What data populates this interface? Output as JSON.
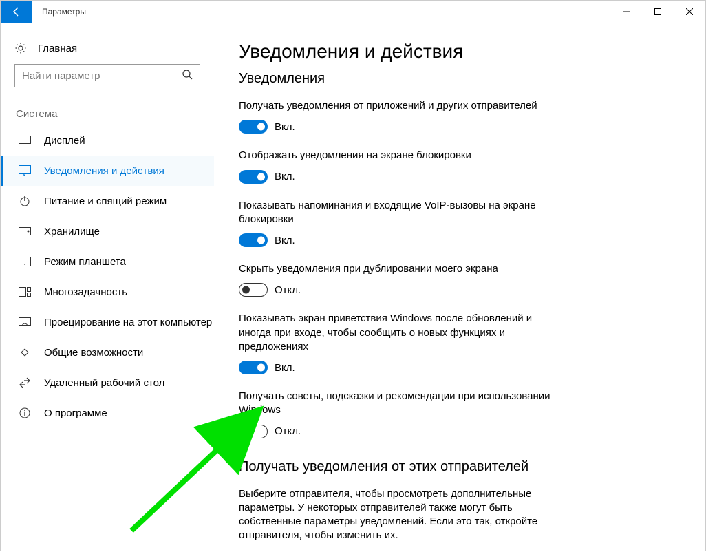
{
  "titlebar": {
    "title": "Параметры"
  },
  "sidebar": {
    "home": "Главная",
    "search_placeholder": "Найти параметр",
    "group": "Система",
    "items": [
      {
        "label": "Дисплей"
      },
      {
        "label": "Уведомления и действия"
      },
      {
        "label": "Питание и спящий режим"
      },
      {
        "label": "Хранилище"
      },
      {
        "label": "Режим планшета"
      },
      {
        "label": "Многозадачность"
      },
      {
        "label": "Проецирование на этот компьютер"
      },
      {
        "label": "Общие возможности"
      },
      {
        "label": "Удаленный рабочий стол"
      },
      {
        "label": "О программе"
      }
    ]
  },
  "main": {
    "heading": "Уведомления и действия",
    "section1": "Уведомления",
    "settings": [
      {
        "label": "Получать уведомления от приложений и других отправителей",
        "state": "on",
        "state_text": "Вкл."
      },
      {
        "label": "Отображать уведомления на экране блокировки",
        "state": "on",
        "state_text": "Вкл."
      },
      {
        "label": "Показывать напоминания и входящие VoIP-вызовы на экране блокировки",
        "state": "on",
        "state_text": "Вкл."
      },
      {
        "label": "Скрыть уведомления при дублировании моего экрана",
        "state": "off",
        "state_text": "Откл."
      },
      {
        "label": "Показывать экран приветствия Windows после обновлений и иногда при входе, чтобы сообщить о новых функциях и предложениях",
        "state": "on",
        "state_text": "Вкл."
      },
      {
        "label": "Получать советы, подсказки и рекомендации при использовании Windows",
        "state": "off",
        "state_text": "Откл."
      }
    ],
    "section2": "Получать уведомления от этих отправителей",
    "section2_desc": "Выберите отправителя, чтобы просмотреть дополнительные параметры. У некоторых отправителей также могут быть собственные параметры уведомлений. Если это так, откройте отправителя, чтобы изменить их."
  }
}
